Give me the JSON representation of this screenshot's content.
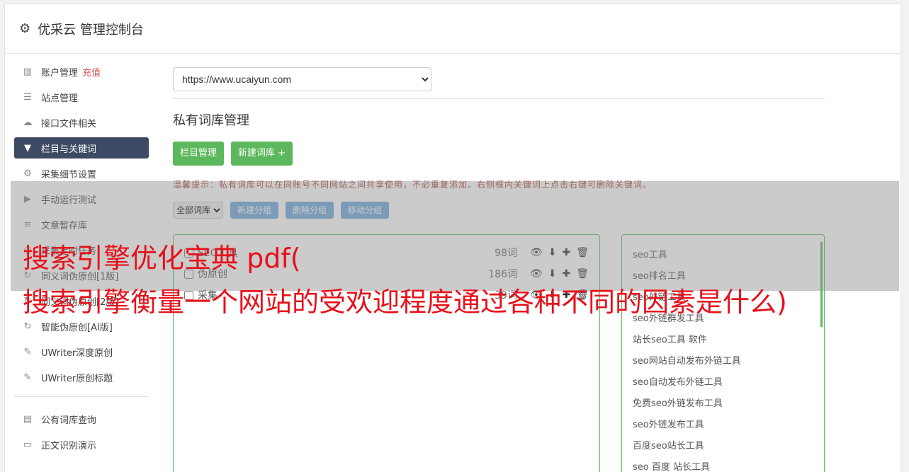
{
  "header": {
    "title": "优采云 管理控制台"
  },
  "sidebar": {
    "items": [
      {
        "label": "账户管理",
        "badge": "充值",
        "icon": "bar-chart-icon"
      },
      {
        "label": "站点管理",
        "icon": "server-icon"
      },
      {
        "label": "接口文件相关",
        "icon": "cloud-upload-icon"
      },
      {
        "label": "栏目与关键词",
        "icon": "filter-icon"
      },
      {
        "label": "采集细节设置",
        "icon": "gears-icon"
      },
      {
        "label": "手动运行测试",
        "icon": "play-icon"
      },
      {
        "label": "文章暂存库",
        "icon": "database-icon"
      },
      {
        "label": "采集定时任务",
        "icon": "clock-icon"
      },
      {
        "label": "同义词伪原创[1版]",
        "icon": "refresh-icon"
      },
      {
        "label": "同义词伪原创[2版]",
        "icon": "refresh-icon"
      },
      {
        "label": "智能伪原创[AI版]",
        "icon": "refresh-icon"
      },
      {
        "label": "UWriter深度原创",
        "icon": "edit-icon"
      },
      {
        "label": "UWriter原创标题",
        "icon": "edit-icon"
      }
    ],
    "items2": [
      {
        "label": "公有词库查询",
        "icon": "book-icon"
      },
      {
        "label": "正文识别演示",
        "icon": "monitor-icon"
      }
    ]
  },
  "main": {
    "site_select": "https://www.ucaiyun.com",
    "page_title": "私有词库管理",
    "btn_column": "栏目管理",
    "btn_new_lib": "新建词库 +",
    "tip": "温馨提示：私有词库可以在同账号不同网站之间共享使用，不必重复添加。右侧框内关键词上点击右键可删除关键词。",
    "filter_select": "全部词库",
    "btn_new_group": "新建分组",
    "btn_delete_group": "删除分组",
    "btn_move_group": "移动分组",
    "groups": [
      {
        "name": "SEO工具",
        "count": "98词"
      },
      {
        "name": "伪原创",
        "count": "186词"
      },
      {
        "name": "采集",
        "count": "39词"
      }
    ],
    "keywords": [
      "seo工具",
      "seo排名工具",
      "seo外链工具",
      "seo外链群发工具",
      "站长seo工具 软件",
      "seo网站自动发布外链工具",
      "seo自动发布外链工具",
      "免费seo外链发布工具",
      "seo外链发布工具",
      "百度seo站长工具",
      "seo 百度 站长工具"
    ]
  },
  "overlay": {
    "line1": "搜索引擎优化宝典 pdf(",
    "line2": "搜索引擎衡量一个网站的受欢迎程度通过各种不同的因素是什么)"
  }
}
